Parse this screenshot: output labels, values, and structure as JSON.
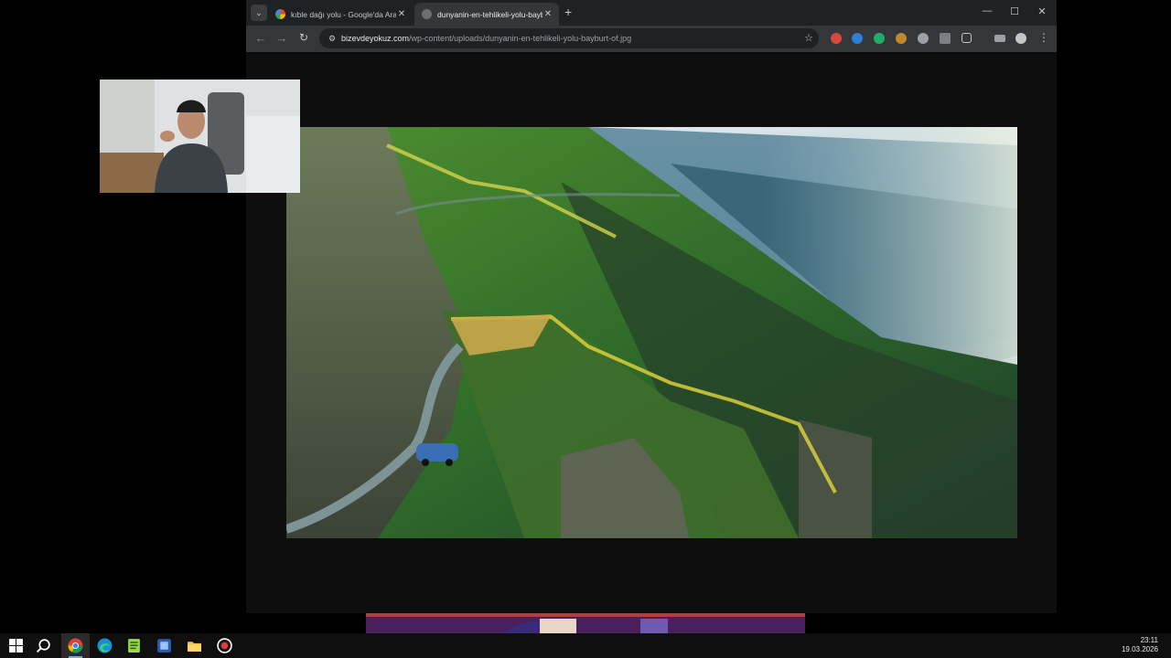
{
  "browser": {
    "tabs": [
      {
        "title": "kıble dağı yolu - Google'da Ara",
        "active": false
      },
      {
        "title": "dunyanin-en-tehlikeli-yolu-bayburt-of.jpg",
        "active": true
      }
    ],
    "new_tab_label": "+",
    "url_host": "bizevdeyokuz.com",
    "url_path": "/wp-content/uploads/dunyanin-en-tehlikeli-yolu-bayburt-of.jpg",
    "window_controls": {
      "minimize": "—",
      "maximize": "☐",
      "close": "✕"
    }
  },
  "taskbar": {
    "apps": [
      "windows-start",
      "search",
      "chrome",
      "edge",
      "notepad-plus",
      "dev-app",
      "file-explorer",
      "recorder"
    ],
    "clock_time": "23:11",
    "clock_date": "19.03.2026"
  },
  "colors": {
    "tab_strip": "#202124",
    "toolbar": "#35363a",
    "page_bg": "#0e0e0e",
    "taskbar": "#0f0f10"
  }
}
